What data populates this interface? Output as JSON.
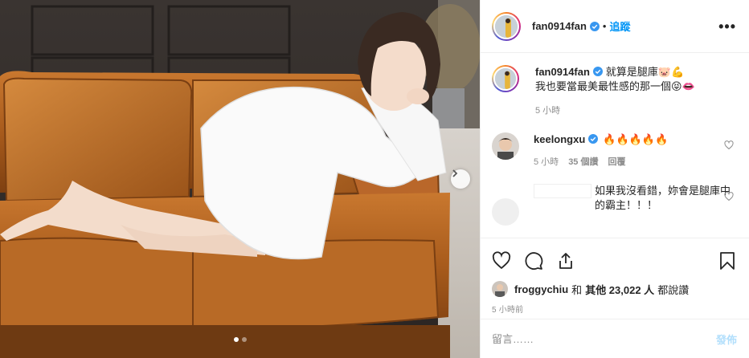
{
  "post": {
    "author": "fan0914fan",
    "follow_label": "追蹤",
    "separator": "•",
    "more_label": "•••"
  },
  "caption": {
    "author": "fan0914fan",
    "line1": "就算是腿庫🐷💪",
    "line2": "我也要當最美最性感的那一個😝👄",
    "time": "5 小時"
  },
  "comments": [
    {
      "author": "keelongxu",
      "text": "🔥🔥🔥🔥🔥",
      "time": "5 小時",
      "likes": "35 個讚",
      "reply_label": "回覆"
    },
    {
      "author": "",
      "text": "如果我沒看錯，妳會是腿庫中的霸主！！！"
    }
  ],
  "likes": {
    "first_liker": "froggychiu",
    "connector": "和",
    "others": "其他 23,022 人",
    "suffix": "都說讚"
  },
  "timestamp": "5 小時前",
  "composer": {
    "placeholder": "留言……",
    "post_label": "發佈"
  },
  "colors": {
    "accent": "#0095f6",
    "post_disabled": "#b2dffc",
    "verified": "#3897f0"
  },
  "carousel": {
    "count": 2,
    "active_index": 0
  }
}
